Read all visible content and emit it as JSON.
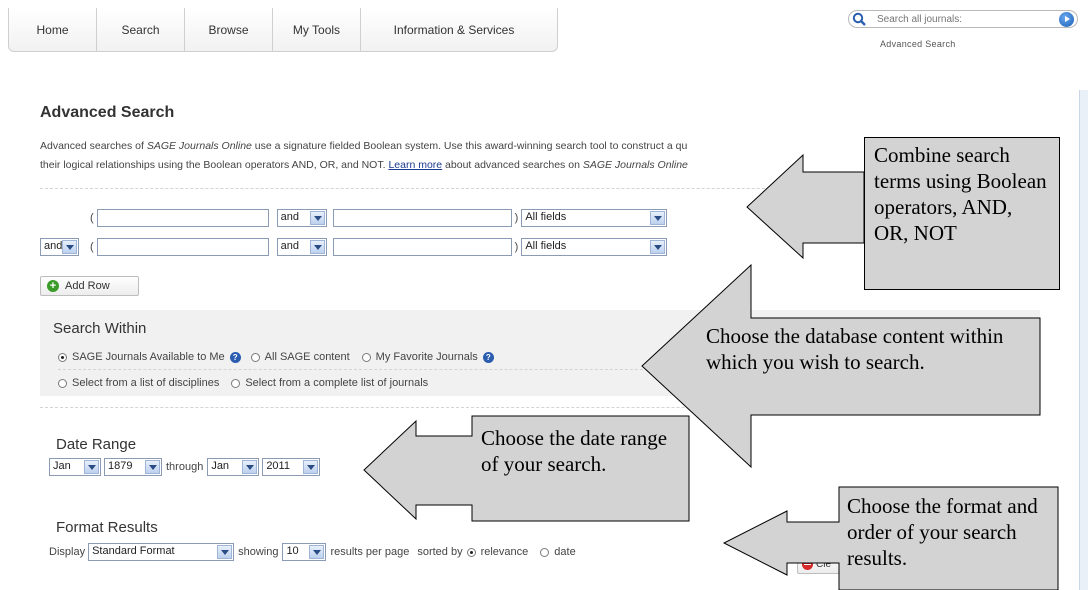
{
  "nav": {
    "tabs": [
      {
        "label": "Home"
      },
      {
        "label": "Search"
      },
      {
        "label": "Browse"
      },
      {
        "label": "My Tools"
      },
      {
        "label": "Information & Services"
      }
    ],
    "search_placeholder": "Search all journals:",
    "advanced_link": "Advanced Search"
  },
  "page": {
    "title": "Advanced Search",
    "intro_line1_a": "Advanced searches of ",
    "intro_line1_em": "SAGE Journals Online",
    "intro_line1_b": " use a signature fielded Boolean system. Use this award-winning search tool to construct a qu",
    "intro_line2_a": "their logical relationships using the Boolean operators AND, OR, and NOT. ",
    "intro_line2_link": "Learn more",
    "intro_line2_b": " about advanced searches on ",
    "intro_line2_em": "SAGE Journals Online"
  },
  "query_rows": [
    {
      "operator": "",
      "term1": "",
      "inner_op": "and",
      "term2": "",
      "field": "All fields"
    },
    {
      "operator": "and",
      "term1": "",
      "inner_op": "and",
      "term2": "",
      "field": "All fields"
    }
  ],
  "add_row_label": "Add Row",
  "search_within": {
    "title": "Search Within",
    "options_row1": [
      {
        "label": "SAGE Journals Available to Me",
        "selected": true,
        "help": true
      },
      {
        "label": "All SAGE content",
        "selected": false,
        "help": false
      },
      {
        "label": "My Favorite Journals",
        "selected": false,
        "help": true
      }
    ],
    "options_row2": [
      {
        "label": "Select from a list of disciplines",
        "selected": false
      },
      {
        "label": "Select from a complete list of journals",
        "selected": false
      }
    ]
  },
  "date_range": {
    "title": "Date Range",
    "from_month": "Jan",
    "from_year": "1879",
    "through_label": "through",
    "to_month": "Jan",
    "to_year": "2011"
  },
  "format_results": {
    "title": "Format Results",
    "display_label": "Display",
    "format": "Standard Format",
    "showing_label": "showing",
    "per_page": "10",
    "per_page_label": "results per page",
    "sorted_label": "sorted by",
    "sort_options": [
      {
        "label": "relevance",
        "selected": true
      },
      {
        "label": "date",
        "selected": false
      }
    ],
    "clear_label": "Cle"
  },
  "callouts": {
    "boolean": "Combine search terms using Boolean operators, AND, OR, NOT",
    "database": "Choose the database content within which you wish to search.",
    "date": "Choose the date range of your search.",
    "format": "Choose the format and order of your search results."
  },
  "colors": {
    "callout_fill": "#d3d3d3",
    "panel_bg": "#f1f1f1",
    "link": "#1a3a8f"
  }
}
